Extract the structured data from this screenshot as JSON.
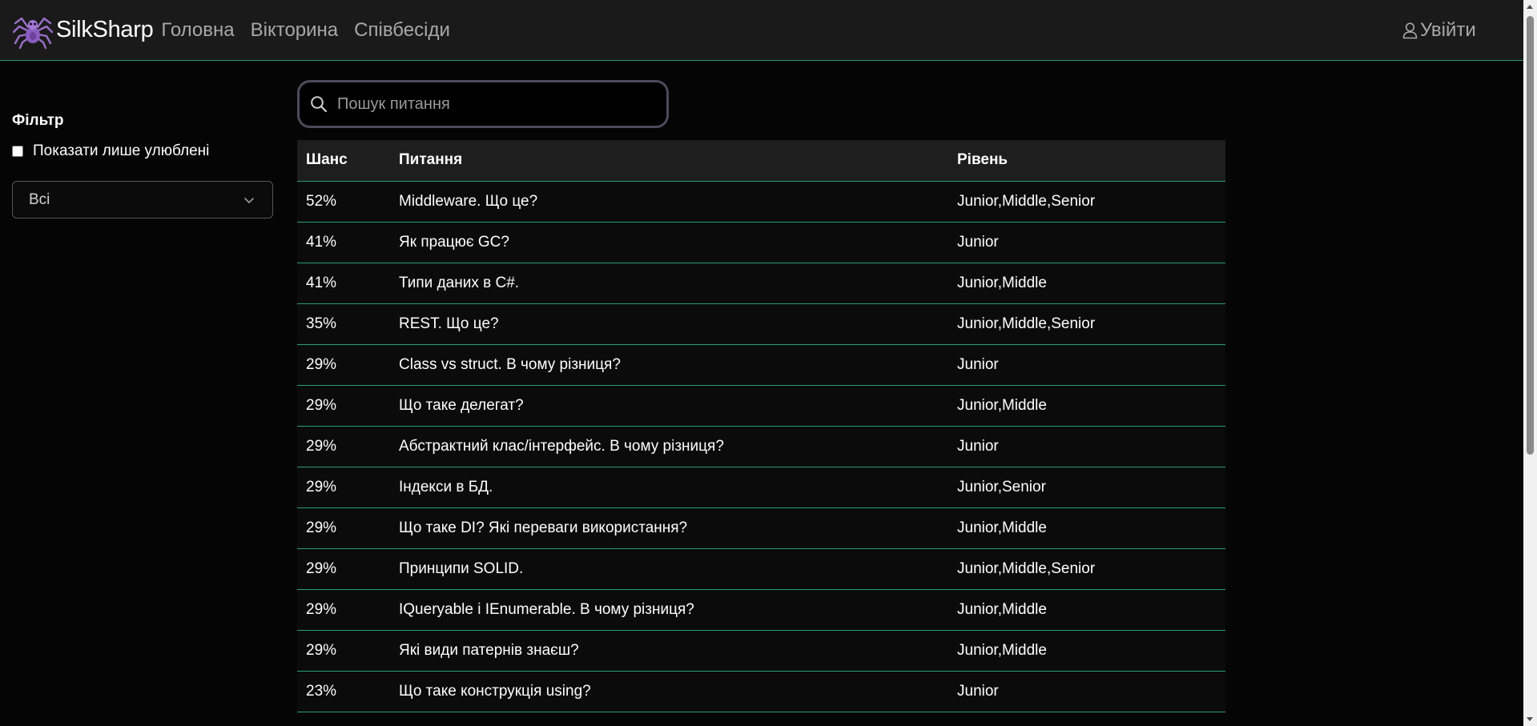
{
  "navbar": {
    "brand_name": "SilkSharp",
    "links": [
      "Головна",
      "Вікторина",
      "Співбесіди"
    ],
    "logout_label": "Увійти"
  },
  "sidebar": {
    "filter_title": "Фільтр",
    "favorites_label": "Показати лише улюблені",
    "favorites_checked": false,
    "level_select_value": "Всі"
  },
  "search": {
    "placeholder": "Пошук питання",
    "value": ""
  },
  "table": {
    "headers": [
      "Шанс",
      "Питання",
      "Рівень"
    ],
    "rows": [
      {
        "chance": "52%",
        "question": "Middleware. Що це?",
        "level": "Junior,Middle,Senior"
      },
      {
        "chance": "41%",
        "question": "Як працює GC?",
        "level": "Junior"
      },
      {
        "chance": "41%",
        "question": "Типи даних в C#.",
        "level": "Junior,Middle"
      },
      {
        "chance": "35%",
        "question": "REST. Що це?",
        "level": "Junior,Middle,Senior"
      },
      {
        "chance": "29%",
        "question": "Class vs struct. В чому різниця?",
        "level": "Junior"
      },
      {
        "chance": "29%",
        "question": "Що таке делегат?",
        "level": "Junior,Middle"
      },
      {
        "chance": "29%",
        "question": "Абстрактний клас/інтерфейс. В чому різниця?",
        "level": "Junior"
      },
      {
        "chance": "29%",
        "question": "Індекси в БД.",
        "level": "Junior,Senior"
      },
      {
        "chance": "29%",
        "question": "Що таке DI? Які переваги використання?",
        "level": "Junior,Middle"
      },
      {
        "chance": "29%",
        "question": "Принципи SOLID.",
        "level": "Junior,Middle,Senior"
      },
      {
        "chance": "29%",
        "question": "IQueryable і IEnumerable. В чому різниця?",
        "level": "Junior,Middle"
      },
      {
        "chance": "29%",
        "question": "Які види патернів знаєш?",
        "level": "Junior,Middle"
      },
      {
        "chance": "23%",
        "question": "Що таке конструкція using?",
        "level": "Junior"
      }
    ]
  },
  "colors": {
    "accent": "#2a9d72",
    "navbar_bg": "#1a1a1a",
    "page_bg": "#050505",
    "logo": "#9b6fc9"
  },
  "icons": {
    "brand": "spider-icon",
    "logout": "user-icon",
    "search": "search-icon",
    "select": "chevron-down-icon"
  }
}
